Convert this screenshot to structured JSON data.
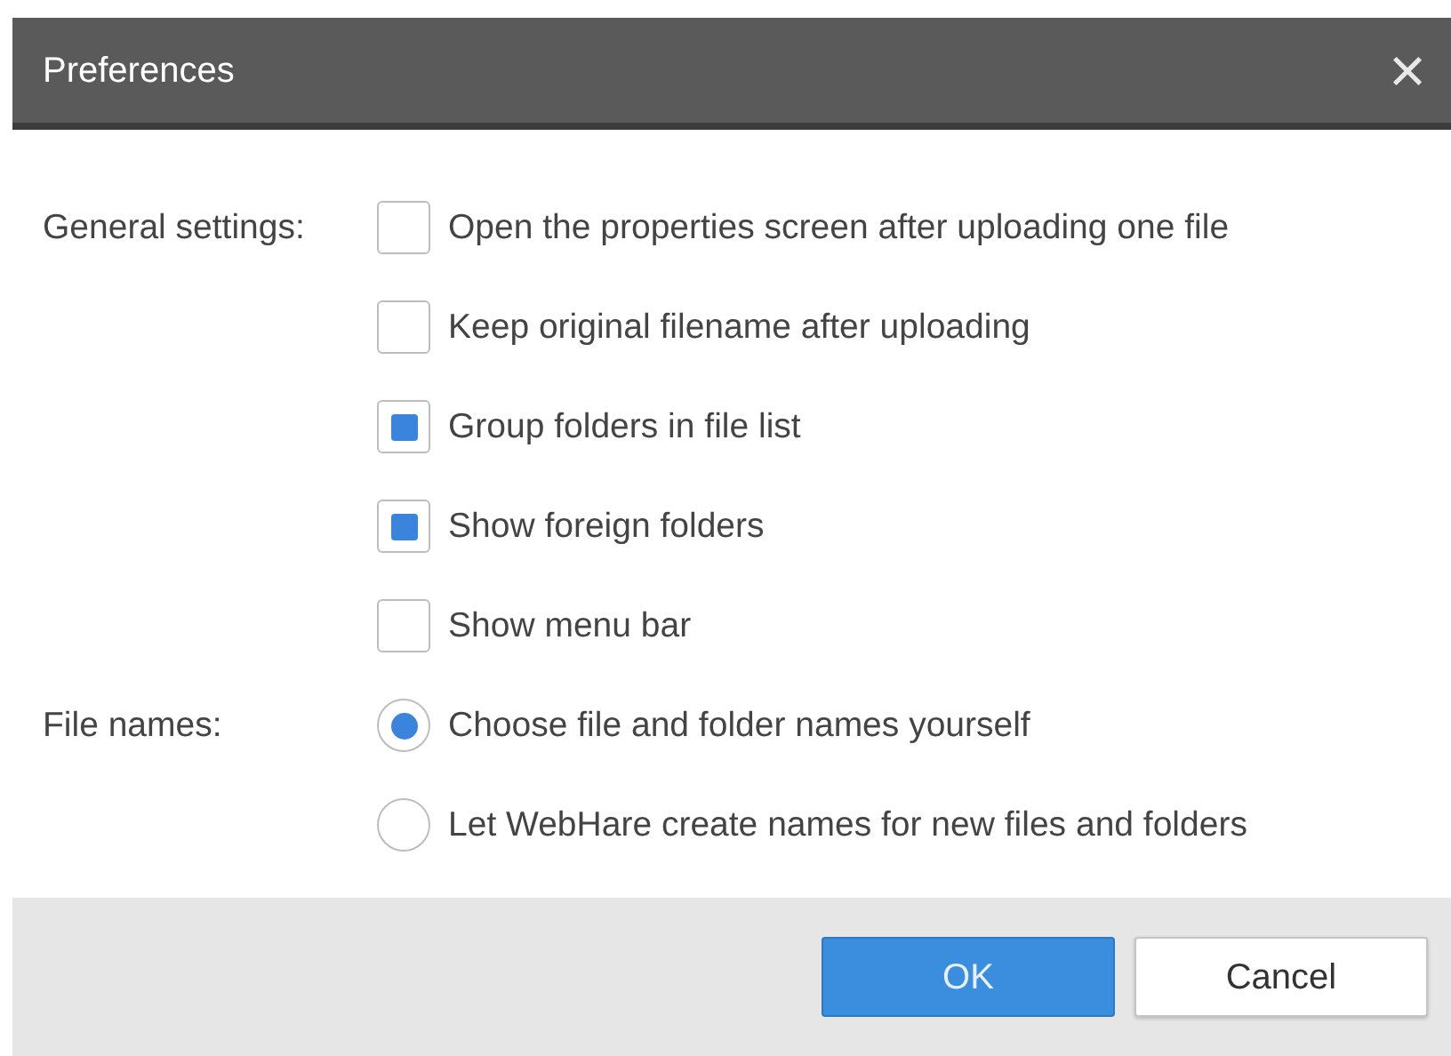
{
  "window": {
    "title": "Preferences",
    "close": "×"
  },
  "groups": [
    {
      "label": "General settings:",
      "kind": "checkbox",
      "options": [
        {
          "label": "Open the properties screen after uploading one file",
          "checked": false
        },
        {
          "label": "Keep original filename after uploading",
          "checked": false
        },
        {
          "label": "Group folders in file list",
          "checked": true
        },
        {
          "label": "Show foreign folders",
          "checked": true
        },
        {
          "label": "Show menu bar",
          "checked": false
        }
      ]
    },
    {
      "label": "File names:",
      "kind": "radio",
      "options": [
        {
          "label": "Choose file and folder names yourself",
          "selected": true
        },
        {
          "label": "Let WebHare create names for new files and folders",
          "selected": false
        }
      ]
    }
  ],
  "buttons": [
    {
      "label": "OK",
      "kind": "primary"
    },
    {
      "label": "Cancel",
      "kind": "secondary"
    }
  ]
}
